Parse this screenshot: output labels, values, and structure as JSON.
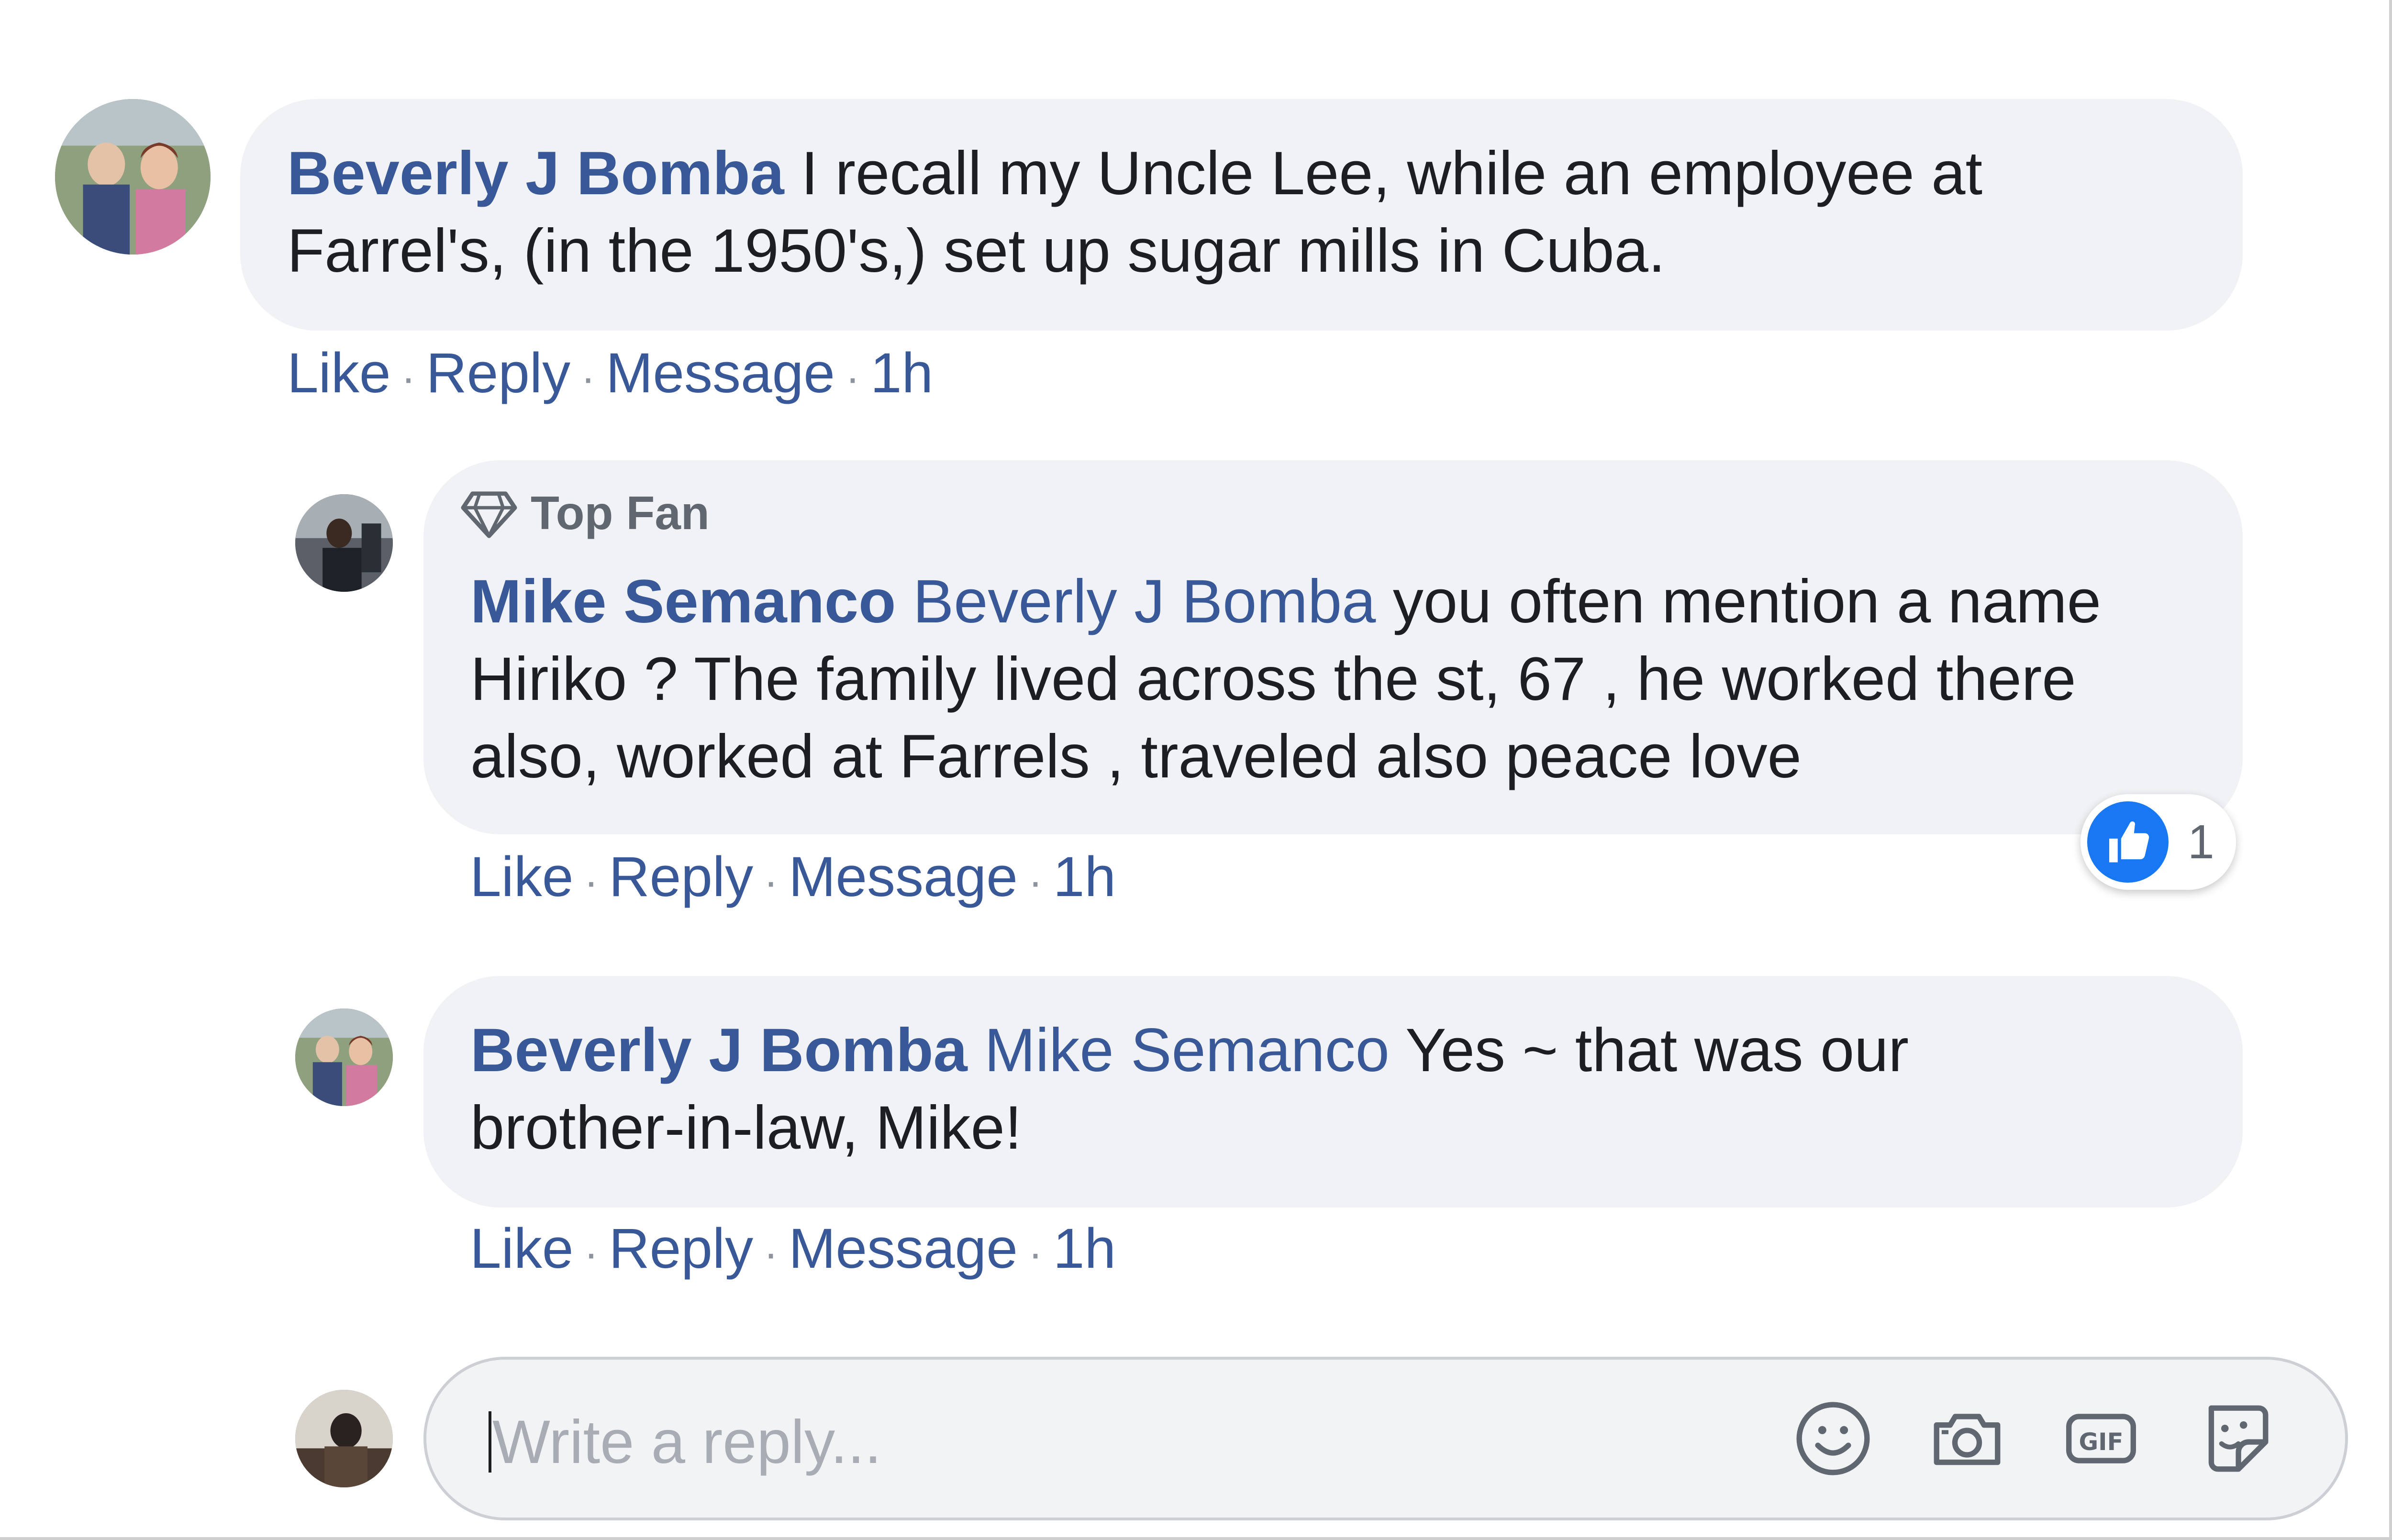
{
  "comments": [
    {
      "author": "Beverly J Bomba",
      "mention": "",
      "text_line1": " I recall my Uncle Lee, while an employee at",
      "text_line2": "Farrel's, (in the 1950's,) set up sugar mills in Cuba.",
      "actions": {
        "like": "Like",
        "reply": "Reply",
        "message": "Message",
        "time": "1h"
      }
    }
  ],
  "replies": [
    {
      "badge": "Top Fan",
      "author": "Mike Semanco",
      "mention": "Beverly J Bomba",
      "text_line1": " you often mention a name",
      "text_line2": "Hiriko ? The family lived across the st, 67 , he worked there",
      "text_line3": "also, worked at Farrels , traveled also peace love",
      "reaction_count": "1",
      "actions": {
        "like": "Like",
        "reply": "Reply",
        "message": "Message",
        "time": "1h"
      }
    },
    {
      "author": "Beverly J Bomba",
      "mention": "Mike Semanco",
      "text_line1": " Yes ~ that was our",
      "text_line2": "brother-in-law, Mike!",
      "actions": {
        "like": "Like",
        "reply": "Reply",
        "message": "Message",
        "time": "1h"
      }
    }
  ],
  "reply_box": {
    "placeholder": "Write a reply...",
    "icons": [
      "smiley-icon",
      "camera-icon",
      "gif-icon",
      "sticker-icon"
    ]
  },
  "colors": {
    "link": "#385898",
    "bubble": "#f0f2f5",
    "like_blue": "#1877f2"
  }
}
